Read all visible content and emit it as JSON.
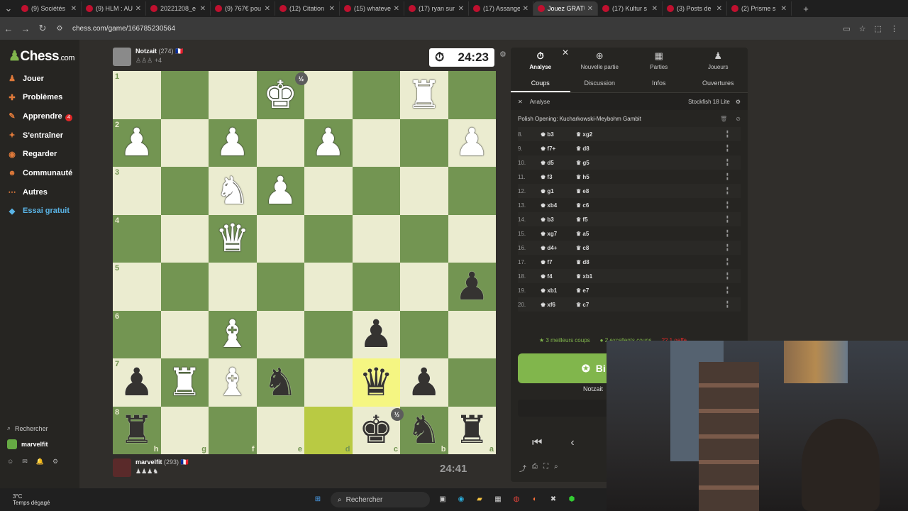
{
  "browser": {
    "tabs": [
      {
        "label": "(9) Sociétés",
        "icon": "youtube-icon"
      },
      {
        "label": "(9) HLM : AU",
        "icon": "youtube-icon"
      },
      {
        "label": "20221208_e",
        "icon": "document-icon"
      },
      {
        "label": "(9) 767€ pou",
        "icon": "youtube-icon"
      },
      {
        "label": "(12) Citation",
        "icon": "x-icon"
      },
      {
        "label": "(15) whateve",
        "icon": "x-icon"
      },
      {
        "label": "(17) ryan sur",
        "icon": "x-icon"
      },
      {
        "label": "(17) Assange",
        "icon": "x-icon"
      },
      {
        "label": "Jouez GRATU",
        "icon": "chess-pawn-icon"
      },
      {
        "label": "(17) Kultur s",
        "icon": "x-icon"
      },
      {
        "label": "(3) Posts de",
        "icon": "x-icon"
      },
      {
        "label": "(2) Prisme s",
        "icon": "x-icon"
      }
    ],
    "url": "chess.com/game/166785230564"
  },
  "sidebar": {
    "logo_prefix": "Chess",
    "logo_suffix": ".com",
    "items": [
      {
        "label": "Jouer",
        "icon": "play-icon"
      },
      {
        "label": "Problèmes",
        "icon": "puzzle-icon"
      },
      {
        "label": "Apprendre",
        "icon": "learn-icon"
      },
      {
        "label": "S'entraîner",
        "icon": "practice-icon"
      },
      {
        "label": "Regarder",
        "icon": "watch-icon"
      },
      {
        "label": "Communauté",
        "icon": "community-icon"
      },
      {
        "label": "Autres",
        "icon": "more-icon"
      },
      {
        "label": "Essai gratuit",
        "icon": "diamond-icon"
      }
    ],
    "play_badge": "4",
    "search_label": "Rechercher",
    "username": "marvelfit"
  },
  "game": {
    "top_player": {
      "name": "Notzait",
      "rating": "(274)",
      "extra": "+4"
    },
    "top_clock": "24:23",
    "bottom_player": {
      "name": "marvelfit",
      "rating": "(293)"
    },
    "bottom_clock": "24:41",
    "half_badge": "½",
    "ranks": [
      "1",
      "2",
      "3",
      "4",
      "5",
      "6",
      "7",
      "8"
    ],
    "files": [
      "h",
      "g",
      "f",
      "e",
      "d",
      "c",
      "b",
      "a"
    ]
  },
  "board": [
    [
      "",
      "",
      "",
      "wK",
      "",
      "",
      "wR",
      ""
    ],
    [
      "wP",
      "",
      "wP",
      "",
      "wP",
      "",
      "",
      "wP"
    ],
    [
      "",
      "",
      "wN",
      "wP",
      "",
      "",
      "",
      ""
    ],
    [
      "",
      "",
      "wQ",
      "",
      "",
      "",
      "",
      ""
    ],
    [
      "",
      "",
      "",
      "",
      "",
      "",
      "",
      "bP"
    ],
    [
      "",
      "",
      "wB",
      "",
      "",
      "bP",
      "",
      ""
    ],
    [
      "bP",
      "wR",
      "wB",
      "bN",
      "",
      "bQ",
      "bP",
      ""
    ],
    [
      "bR",
      "",
      "",
      "",
      "",
      "bK",
      "bN",
      "bR"
    ]
  ],
  "panel": {
    "tabs": [
      {
        "label": "Analyse",
        "icon": "stopwatch-icon"
      },
      {
        "label": "Nouvelle partie",
        "icon": "plus-icon"
      },
      {
        "label": "Parties",
        "icon": "board-icon"
      },
      {
        "label": "Joueurs",
        "icon": "players-icon"
      }
    ],
    "subtabs": [
      "Coups",
      "Discussion",
      "Infos",
      "Ouvertures"
    ],
    "analysis_label": "Analyse",
    "engine": "Stockfish 18 Lite",
    "opening": "Polish Opening: Kucharkowski-Meybohm Gambit",
    "moves": [
      {
        "n": "8.",
        "w": "b3",
        "b": "xg2"
      },
      {
        "n": "9.",
        "w": "f7+",
        "b": "d8"
      },
      {
        "n": "10.",
        "w": "d5",
        "b": "g5"
      },
      {
        "n": "11.",
        "w": "f3",
        "b": "h5"
      },
      {
        "n": "12.",
        "w": "g1",
        "b": "e8"
      },
      {
        "n": "13.",
        "w": "xb4",
        "b": "c6"
      },
      {
        "n": "14.",
        "w": "b3",
        "b": "f5"
      },
      {
        "n": "15.",
        "w": "xg7",
        "b": "a5"
      },
      {
        "n": "16.",
        "w": "d4+",
        "b": "c8"
      },
      {
        "n": "17.",
        "w": "f7",
        "b": "d8"
      },
      {
        "n": "18.",
        "w": "f4",
        "b": "xb1"
      },
      {
        "n": "19.",
        "w": "xb1",
        "b": "e7"
      },
      {
        "n": "20.",
        "w": "xf6",
        "b": "c7"
      }
    ],
    "summary": {
      "best": "3 meilleurs coups",
      "excellent": "2 excellents coups",
      "blunder": "1 gaffe"
    },
    "review_label": "Bi",
    "review_sub": "Notzait",
    "close_symbol": "✕"
  },
  "taskbar": {
    "temp": "3°C",
    "weather": "Temps dégagé",
    "search": "Rechercher"
  }
}
